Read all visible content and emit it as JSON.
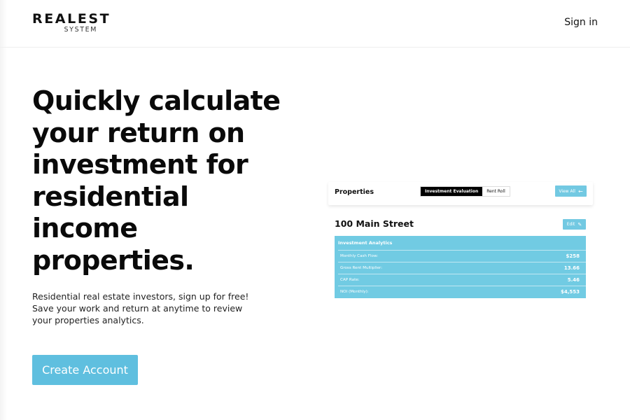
{
  "header": {
    "logo_main": "REALEST",
    "logo_sub": "SYSTEM",
    "signin_label": "Sign in"
  },
  "hero": {
    "title": "Quickly calculate your return on investment for residential income properties.",
    "subtitle": "Residential real estate investors, sign up for free! Save your work and return at anytime to review your properties analytics.",
    "cta_label": "Create Account"
  },
  "mockup": {
    "bar_title": "Properties",
    "tabs": [
      {
        "label": "Investment Evaluation",
        "active": true
      },
      {
        "label": "Rent Roll",
        "active": false
      }
    ],
    "view_all_label": "View All",
    "view_all_icon": "arrow-left-icon",
    "address": "100 Main Street",
    "edit_label": "Edit",
    "edit_icon": "pencil-icon",
    "table_title": "Investment Analytics",
    "rows": [
      {
        "label": "Monthly Cash Flow:",
        "value": "$258"
      },
      {
        "label": "Gross Rent Multiplier:",
        "value": "13.66"
      },
      {
        "label": "CAP Rate:",
        "value": "5.46"
      },
      {
        "label": "NOI (Monthly):",
        "value": "$4,553"
      }
    ]
  },
  "colors": {
    "accent": "#5fbfdf",
    "mockup_accent": "#71cbe3",
    "text": "#0a0a0a"
  }
}
